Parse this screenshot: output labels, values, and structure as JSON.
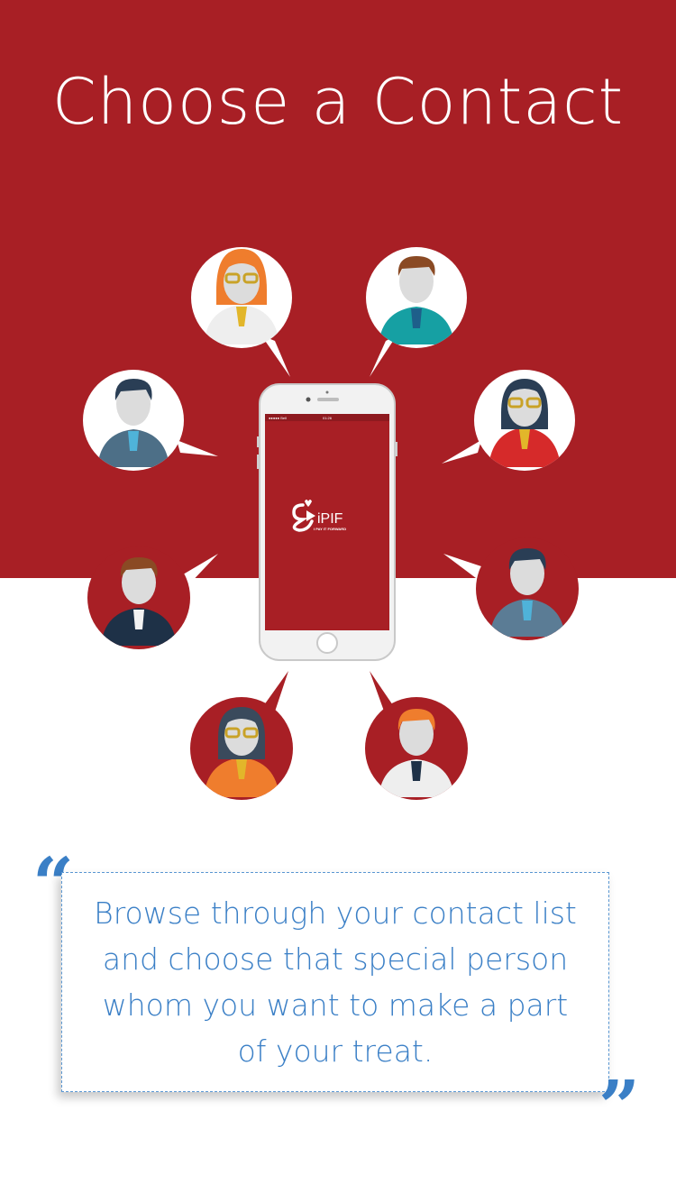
{
  "header": {
    "title": "Choose a Contact"
  },
  "phone": {
    "status_time": "01:26",
    "status_carrier": "●●●●● Bell",
    "app_name": "iPIF",
    "app_tagline": "I PAY IT FORWARD"
  },
  "contacts": [
    {
      "name": "contact-avatar-woman-glasses-orange-hair"
    },
    {
      "name": "contact-avatar-man-teal-shirt"
    },
    {
      "name": "contact-avatar-man-blue-suit"
    },
    {
      "name": "contact-avatar-woman-glasses-red-jacket"
    },
    {
      "name": "contact-avatar-man-navy-suit"
    },
    {
      "name": "contact-avatar-man-grey-suit"
    },
    {
      "name": "contact-avatar-woman-glasses-orange-jacket"
    },
    {
      "name": "contact-avatar-man-orange-hair"
    }
  ],
  "quote": {
    "open_mark": "“",
    "close_mark": "”",
    "text": "Browse through your contact list and choose that special person whom you want to make a part of your treat."
  },
  "colors": {
    "brand_red": "#a81f25",
    "accent_blue": "#3a7fc6",
    "white": "#ffffff"
  }
}
